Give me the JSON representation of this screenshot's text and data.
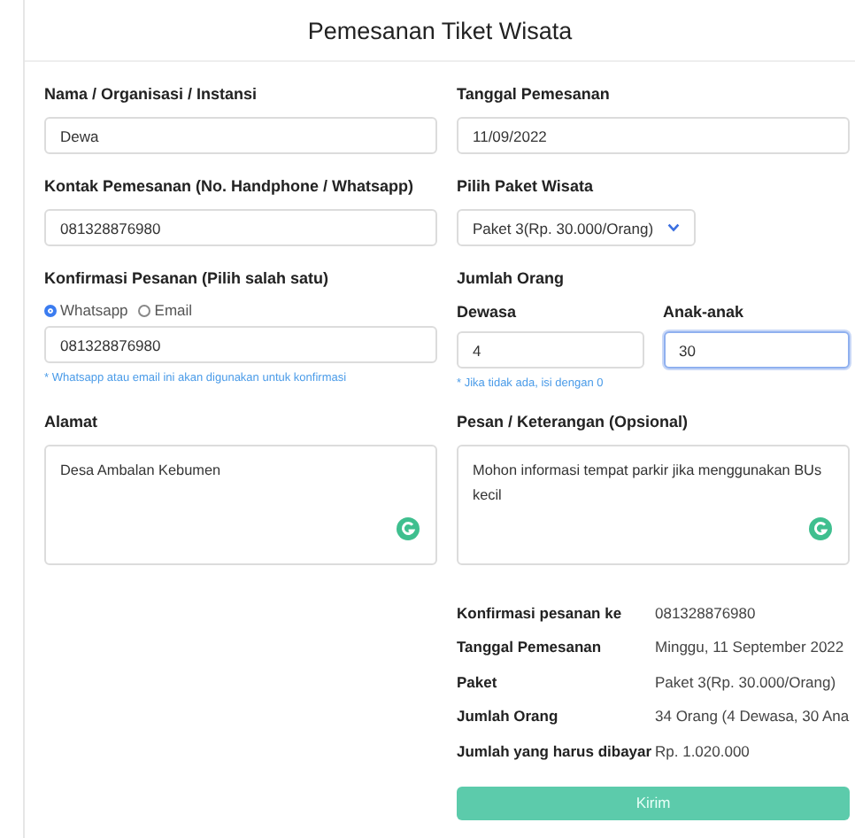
{
  "title": "Pemesanan Tiket Wisata",
  "fields": [
    {
      "kind": "text",
      "label": "Nama / Organisasi / Instansi",
      "value": "Dewa"
    },
    {
      "kind": "text",
      "label": "Tanggal Pemesanan",
      "value": "11/09/2022"
    },
    {
      "kind": "text",
      "label": "Kontak Pemesanan (No. Handphone / Whatsapp)",
      "value": "081328876980"
    },
    {
      "kind": "select",
      "label": "Pilih Paket Wisata",
      "value": "Paket 3(Rp. 30.000/Orang)"
    },
    {
      "kind": "radio",
      "label": "Konfirmasi Pesanan (Pilih salah satu)",
      "options": [
        {
          "label": "Whatsapp",
          "selected": true
        },
        {
          "label": "Email",
          "selected": false
        }
      ],
      "value": "081328876980",
      "hint": "* Whatsapp atau email ini akan digunakan untuk konfirmasi"
    },
    {
      "kind": "count",
      "label": "Jumlah Orang",
      "items": [
        {
          "label": "Dewasa",
          "value": "4",
          "focused": false
        },
        {
          "label": "Anak-anak",
          "value": "30",
          "focused": true
        }
      ],
      "hint": "* Jika tidak ada, isi dengan 0"
    },
    {
      "kind": "textarea",
      "label": "Alamat",
      "value": "Desa Ambalan Kebumen"
    },
    {
      "kind": "textarea",
      "label": "Pesan / Keterangan (Opsional)",
      "value": "Mohon informasi tempat parkir jika menggunakan BUs kecil"
    }
  ],
  "summary": [
    {
      "label": "Konfirmasi pesanan ke",
      "value": "081328876980"
    },
    {
      "label": "Tanggal Pemesanan",
      "value": "Minggu, 11 September 2022"
    },
    {
      "label": "Paket",
      "value": "Paket 3(Rp. 30.000/Orang)"
    },
    {
      "label": "Jumlah Orang",
      "value": "34 Orang (4 Dewasa, 30 Ana"
    },
    {
      "label": "Jumlah yang harus dibayar",
      "value": "Rp. 1.020.000"
    }
  ],
  "submit_button": "Kirim"
}
